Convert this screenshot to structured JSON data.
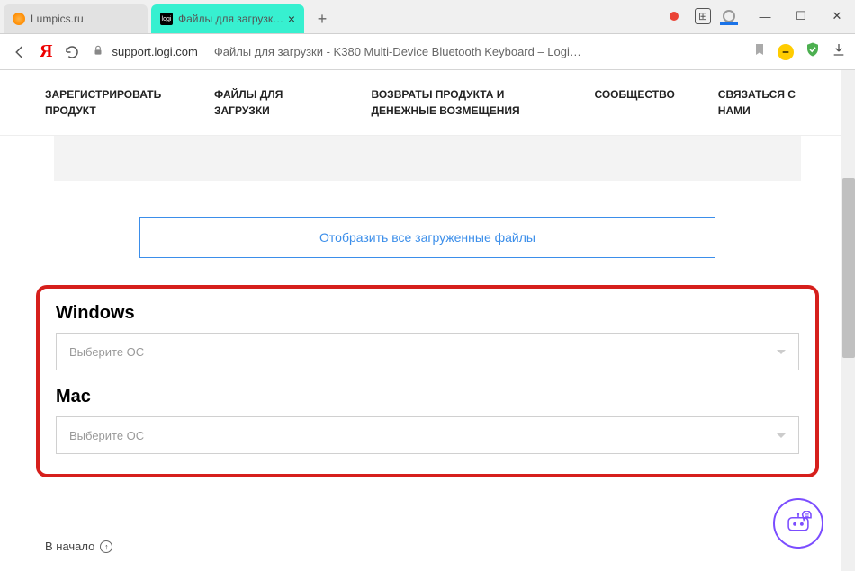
{
  "browser": {
    "tabs": [
      {
        "label": "Lumpics.ru",
        "active": false
      },
      {
        "label": "Файлы для загрузки - K…",
        "active": true,
        "logi": "logi"
      }
    ],
    "url_domain": "support.logi.com",
    "url_title": "Файлы для загрузки - K380 Multi-Device Bluetooth Keyboard – Logi…"
  },
  "topnav": [
    "ЗАРЕГИСТРИРОВАТЬ ПРОДУКТ",
    "ФАЙЛЫ ДЛЯ ЗАГРУЗКИ",
    "ВОЗВРАТЫ ПРОДУКТА И ДЕНЕЖНЫЕ ВОЗМЕЩЕНИЯ",
    "СООБЩЕСТВО",
    "СВЯЗАТЬСЯ С НАМИ"
  ],
  "show_all_label": "Отобразить все загруженные файлы",
  "os_sections": [
    {
      "title": "Windows",
      "placeholder": "Выберите ОС"
    },
    {
      "title": "Mac",
      "placeholder": "Выберите ОС"
    }
  ],
  "back_to_top": "В начало"
}
